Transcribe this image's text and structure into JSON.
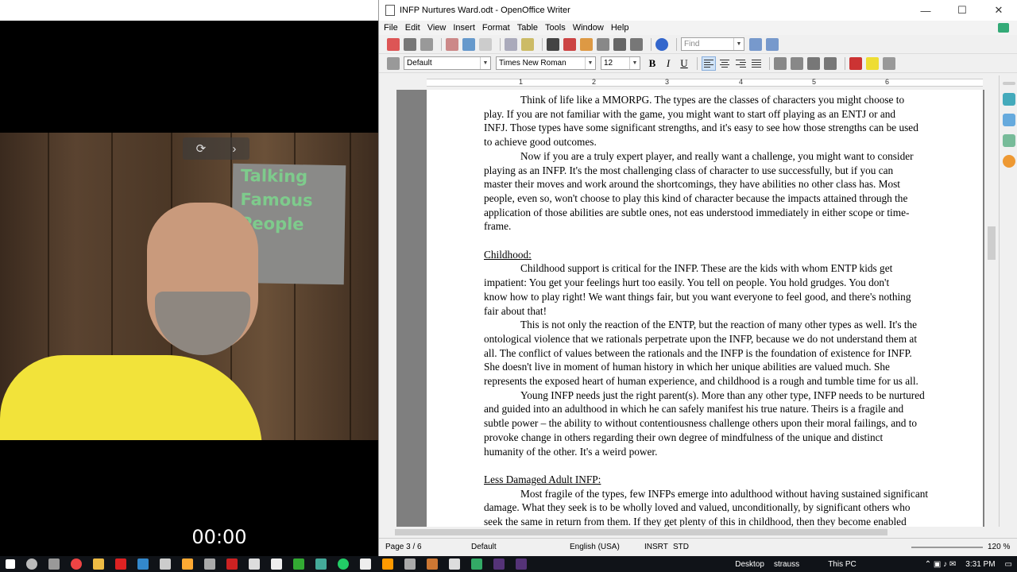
{
  "recording": {
    "timer": "00:00"
  },
  "poster": {
    "lines": [
      "Talking",
      "Famous",
      "People"
    ]
  },
  "window": {
    "title": "INFP Nurtures Ward.odt - OpenOffice Writer",
    "min": "—",
    "max": "☐",
    "close": "✕"
  },
  "menu": [
    "File",
    "Edit",
    "View",
    "Insert",
    "Format",
    "Table",
    "Tools",
    "Window",
    "Help"
  ],
  "find": {
    "placeholder": "Find"
  },
  "format_bar": {
    "style": "Default",
    "font": "Times New Roman",
    "size": "12",
    "bold": "B",
    "italic": "I",
    "underline": "U"
  },
  "ruler": {
    "numbers": [
      "1",
      "2",
      "3",
      "4",
      "5",
      "6"
    ]
  },
  "document": {
    "lines": [
      {
        "t": "Think of life like a MMORPG.  The types are the classes of characters you might choose to",
        "indent": true
      },
      {
        "t": "play.  If you are not familiar with the game, you might want to start off playing as an ENTJ or and"
      },
      {
        "t": "INFJ.  Those types have some significant strengths, and it's easy to see how those strengths can be used"
      },
      {
        "t": "to achieve good outcomes."
      },
      {
        "t": "Now if you are a truly expert player, and really want a challenge, you might want to consider",
        "indent": true
      },
      {
        "t": "playing as an INFP.  It's the most challenging class of character to use successfully, but if you can"
      },
      {
        "t": "master their moves and work around the shortcomings, they have abilities no other class has.  Most"
      },
      {
        "t": "people, even so, won't choose to play this kind of character because the impacts attained through the"
      },
      {
        "t": "application of those abilities are subtle ones, not eas understood immediately in either scope or time-"
      },
      {
        "t": "frame."
      },
      {
        "t": ""
      },
      {
        "t": "Childhood:",
        "heading": true
      },
      {
        "t": "Childhood support is critical for the INFP.  These are the kids with whom ENTP kids get",
        "indent": true
      },
      {
        "t": "impatient:   You get your feelings hurt too easily.  You tell on people.  You hold grudges.  You don't"
      },
      {
        "t": "know how to play right!  We want things fair, but you want everyone to feel good, and there's nothing"
      },
      {
        "t": "fair about that!"
      },
      {
        "t": "This is not only the reaction of the ENTP, but the reaction of many other types as well.  It's the",
        "indent": true
      },
      {
        "t": "ontological violence that we rationals perpetrate upon the INFP, because we do not understand them at"
      },
      {
        "t": "all.  The conflict of values between the rationals and the INFP is the foundation of existence for INFP."
      },
      {
        "t": "She doesn't live in moment of human history in which her unique abilities are valued much.  She"
      },
      {
        "t": "represents the exposed heart of human experience, and childhood is a rough and tumble time for us all."
      },
      {
        "t": "Young INFP needs just the right parent(s).  More than any other type, INFP needs to be nurtured",
        "indent": true
      },
      {
        "t": "and guided into an adulthood in which he can safely manifest his true nature.  Theirs is a fragile and"
      },
      {
        "t": "subtle power – the ability to without contentiousness challenge others upon their moral failings, and to"
      },
      {
        "t": "provoke change in others regarding their own degree of mindfulness of the unique and distinct"
      },
      {
        "t": "humanity of the other.  It's a weird power."
      },
      {
        "t": ""
      },
      {
        "t": "Less Damaged Adult INFP:",
        "heading": true
      },
      {
        "t": "Most fragile of the types, few INFPs emerge into adulthood without having sustained significant",
        "indent": true
      },
      {
        "t": "damage.  What they seek is to be wholly loved and valued, unconditionally, by significant others who"
      },
      {
        "t": "seek the same in return from them.   If they get plenty of this in childhood, then they become enabled"
      }
    ]
  },
  "status": {
    "page": "Page 3 / 6",
    "style": "Default",
    "language": "English (USA)",
    "mode": "INSRT",
    "selection": "STD",
    "zoom": "120 %"
  },
  "taskbar": {
    "desktop": "Desktop",
    "user": "strauss",
    "this_pc": "This PC",
    "time": "3:31 PM"
  }
}
